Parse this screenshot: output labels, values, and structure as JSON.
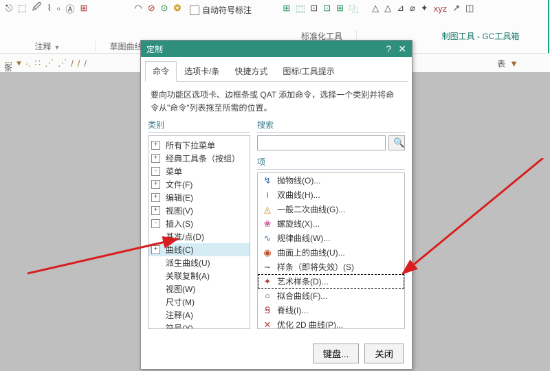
{
  "ribbon": {
    "groups": {
      "ann": {
        "label": "注释"
      },
      "curve": {
        "label": "草图曲线"
      },
      "sheet": {
        "label": "表"
      },
      "std": {
        "label": "标准化工具"
      },
      "draft": {
        "label": "制图工具 - GC工具箱"
      }
    },
    "auto_symbol": "自动符号标注",
    "strip2_end": "条"
  },
  "dialog": {
    "title": "定制",
    "tabs": [
      "命令",
      "选项卡/条",
      "快捷方式",
      "图标/工具提示"
    ],
    "active_tab": 0,
    "instructions": "要向功能区选项卡、边框条或 QAT 添加命令，选择一个类别并将命令从\"命令\"列表拖至所需的位置。",
    "category_heading": "类别",
    "search_heading": "搜索",
    "items_heading": "项",
    "search_placeholder": "",
    "search_button_glyph": "🔍",
    "tree": [
      {
        "level": 1,
        "exp": "+",
        "label": "所有下拉菜单"
      },
      {
        "level": 1,
        "exp": "+",
        "label": "经典工具条（按组）"
      },
      {
        "level": 1,
        "exp": "-",
        "label": "菜单"
      },
      {
        "level": 2,
        "exp": "+",
        "label": "文件(F)"
      },
      {
        "level": 2,
        "exp": "+",
        "label": "编辑(E)"
      },
      {
        "level": 2,
        "exp": "+",
        "label": "视图(V)"
      },
      {
        "level": 2,
        "exp": "-",
        "label": "插入(S)"
      },
      {
        "level": 3,
        "exp": "",
        "label": "基准/点(D)"
      },
      {
        "level": 3,
        "exp": "+",
        "label": "曲线(C)",
        "selected": true
      },
      {
        "level": 3,
        "exp": "",
        "label": "派生曲线(U)"
      },
      {
        "level": 3,
        "exp": "",
        "label": "关联复制(A)"
      },
      {
        "level": 3,
        "exp": "",
        "label": "视图(W)"
      },
      {
        "level": 3,
        "exp": "",
        "label": "尺寸(M)"
      },
      {
        "level": 3,
        "exp": "",
        "label": "注释(A)"
      },
      {
        "level": 3,
        "exp": "",
        "label": "符号(Y)"
      }
    ],
    "items": [
      {
        "icon": "↯",
        "color": "#2a6db0",
        "label": "抛物线(O)..."
      },
      {
        "icon": "≀",
        "color": "#2a6db0",
        "label": "双曲线(H)..."
      },
      {
        "icon": "◬",
        "color": "#d08a2a",
        "label": "一般二次曲线(G)..."
      },
      {
        "icon": "❀",
        "color": "#c05a9a",
        "label": "螺旋线(X)..."
      },
      {
        "icon": "∿",
        "color": "#2a6db0",
        "label": "规律曲线(W)..."
      },
      {
        "icon": "◉",
        "color": "#c0502a",
        "label": "曲面上的曲线(U)..."
      },
      {
        "icon": "∼",
        "color": "#333",
        "label": "样条（即将失效）(S)"
      },
      {
        "icon": "✦",
        "color": "#b23a3a",
        "label": "艺术样条(D)...",
        "target": true
      },
      {
        "icon": "○",
        "color": "#333",
        "label": "拟合曲线(F)..."
      },
      {
        "icon": "Ꞩ",
        "color": "#b23a3a",
        "label": "脊线(I)..."
      },
      {
        "icon": "✕",
        "color": "#b23a3a",
        "label": "优化 2D 曲线(P)..."
      }
    ],
    "keyboard_btn": "键盘...",
    "close_btn": "关闭"
  }
}
